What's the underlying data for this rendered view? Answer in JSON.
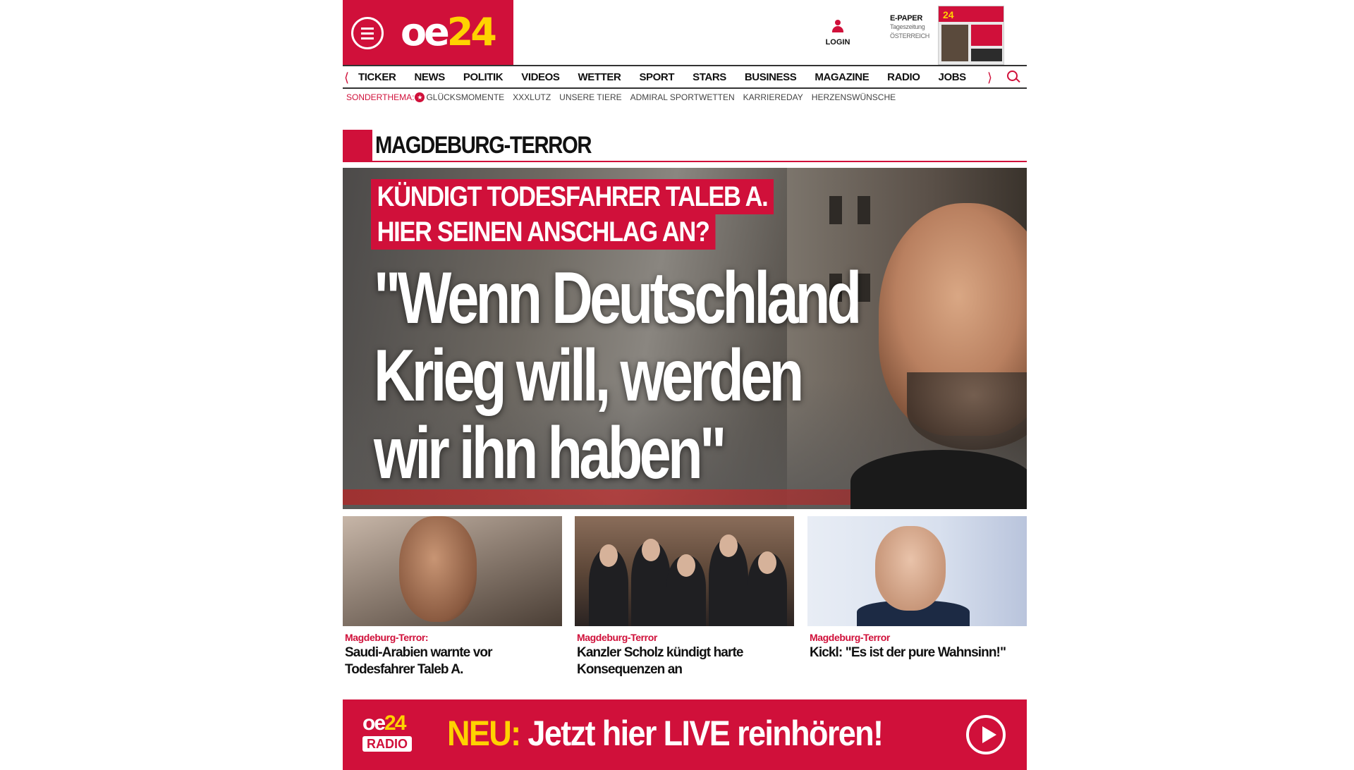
{
  "header": {
    "logo_oe": "oe",
    "logo_24": "24",
    "login_label": "LOGIN",
    "epaper": {
      "title": "E-PAPER",
      "line2": "Tageszeitung",
      "line3": "ÖSTERREICH"
    }
  },
  "nav": {
    "items": [
      "TICKER",
      "NEWS",
      "POLITIK",
      "VIDEOS",
      "WETTER",
      "SPORT",
      "STARS",
      "BUSINESS",
      "MAGAZINE",
      "RADIO",
      "JOBS"
    ]
  },
  "subnav": {
    "label": "SONDERTHEMA:",
    "items": [
      "Glücksmomente",
      "XXXLutz",
      "Unsere Tiere",
      "Admiral Sportwetten",
      "KARRIEREDAY",
      "Herzenswünsche"
    ]
  },
  "section": {
    "title": "MAGDEBURG-TERROR"
  },
  "hero": {
    "kicker_line1": "KÜNDIGT TODESFAHRER TALEB A.",
    "kicker_line2": "HIER SEINEN ANSCHLAG AN?",
    "headline_line1": "\"Wenn Deutschland",
    "headline_line2": "Krieg will, werden",
    "headline_line3": "wir ihn haben\""
  },
  "teasers": [
    {
      "kicker": "Magdeburg-Terror:",
      "title": "Saudi-Arabien warnte vor Todesfahrer Taleb A."
    },
    {
      "kicker": "Magdeburg-Terror",
      "title": "Kanzler Scholz kündigt harte Konsequenzen an"
    },
    {
      "kicker": "Magdeburg-Terror",
      "title": "Kickl: \"Es ist der pure Wahnsinn!\""
    }
  ],
  "radio": {
    "logo_oe": "oe",
    "logo_24": "24",
    "logo_tag": "RADIO",
    "neu": "NEU:",
    "text": " Jetzt hier LIVE reinhören!"
  },
  "colors": {
    "brand_red": "#d0103a",
    "brand_yellow": "#ffd200"
  }
}
